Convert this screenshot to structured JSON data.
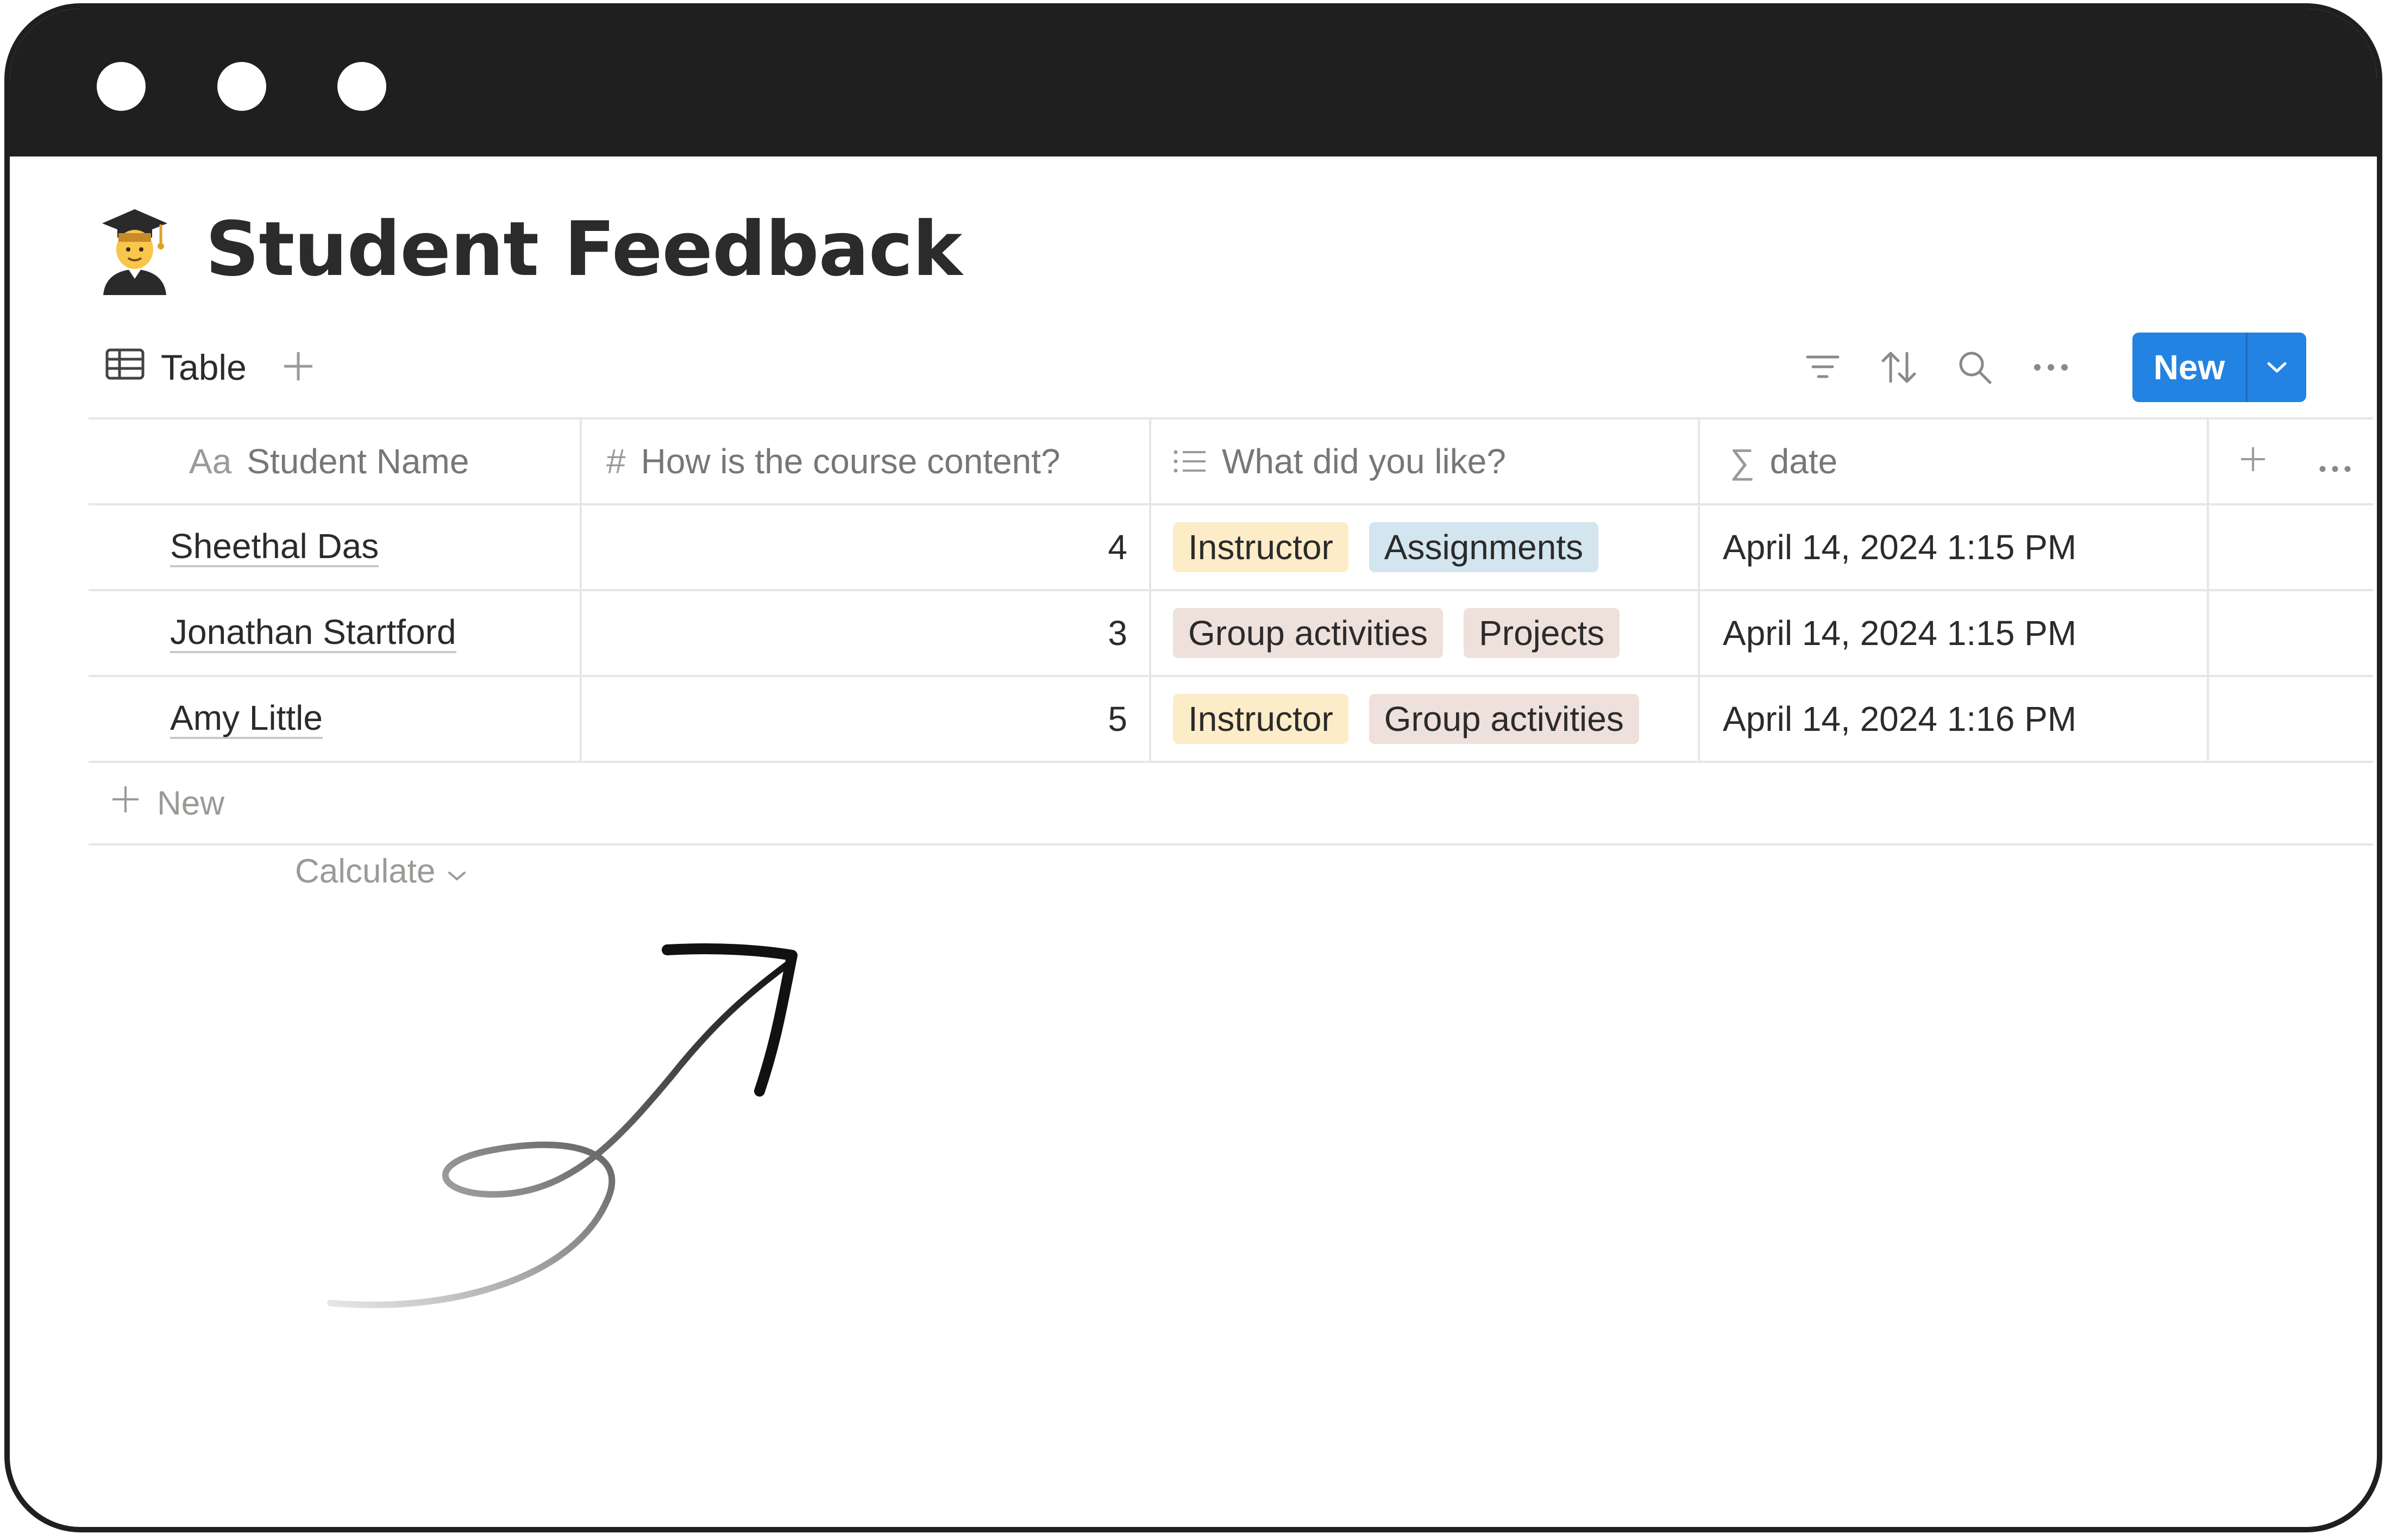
{
  "page": {
    "emoji": "🧑‍🎓",
    "title": "Student Feedback"
  },
  "toolbar": {
    "view_label": "Table",
    "view_icon": "table-icon",
    "add_view_icon": "plus-icon",
    "icons": [
      "filter-icon",
      "sort-icon",
      "search-icon",
      "more-icon"
    ],
    "new_label": "New"
  },
  "columns": [
    {
      "icon": "text-icon",
      "icon_text": "Aa",
      "label": "Student Name"
    },
    {
      "icon": "number-icon",
      "icon_text": "#",
      "label": "How is the course content?"
    },
    {
      "icon": "multi-select-icon",
      "label": "What did you like?"
    },
    {
      "icon": "formula-icon",
      "icon_text": "∑",
      "label": "date"
    }
  ],
  "rows": [
    {
      "name": "Sheethal Das",
      "rating": "4",
      "tags": [
        {
          "label": "Instructor",
          "color": "#fdecc8"
        },
        {
          "label": "Assignments",
          "color": "#d3e5ef"
        }
      ],
      "date": "April 14, 2024 1:15 PM"
    },
    {
      "name": "Jonathan Startford",
      "rating": "3",
      "tags": [
        {
          "label": "Group activities",
          "color": "#eee0da"
        },
        {
          "label": "Projects",
          "color": "#eee0da"
        }
      ],
      "date": "April 14, 2024 1:15 PM"
    },
    {
      "name": "Amy Little",
      "rating": "5",
      "tags": [
        {
          "label": "Instructor",
          "color": "#fdecc8"
        },
        {
          "label": "Group activities",
          "color": "#eee0da"
        }
      ],
      "date": "April 14, 2024 1:16 PM"
    }
  ],
  "table": {
    "new_row_label": "New",
    "calculate_label": "Calculate"
  },
  "colors": {
    "accent": "#2383e2",
    "frame": "#1f1f1f"
  }
}
